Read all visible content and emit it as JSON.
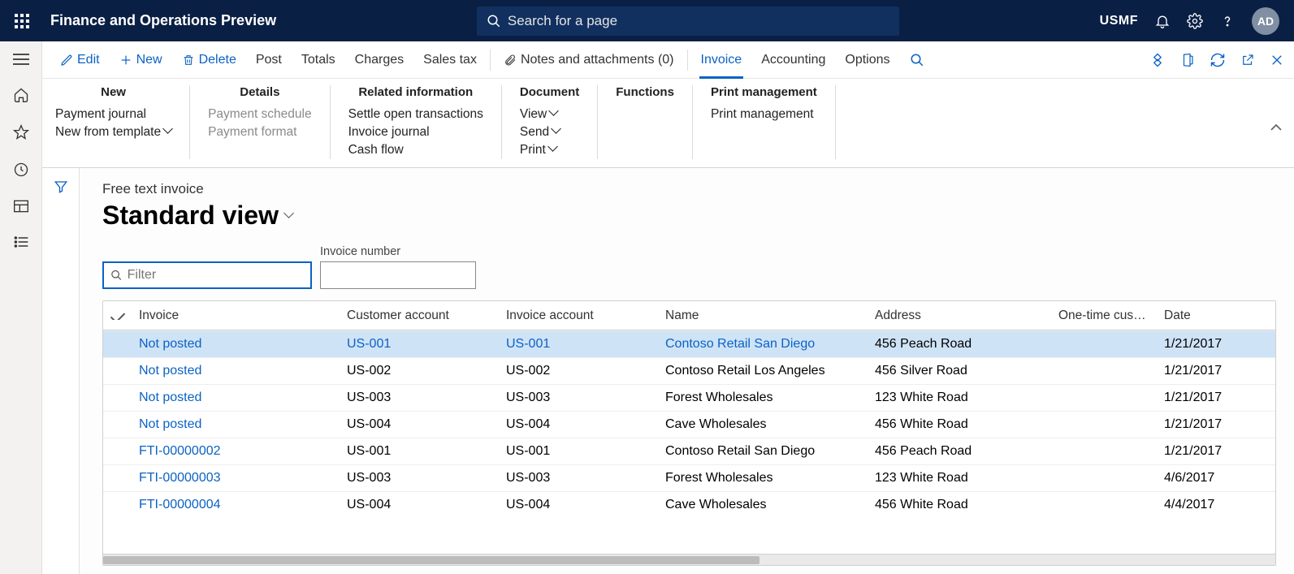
{
  "banner": {
    "title": "Finance and Operations Preview",
    "search_placeholder": "Search for a page",
    "company": "USMF",
    "avatar": "AD"
  },
  "actionbar": {
    "edit": "Edit",
    "new": "New",
    "delete": "Delete",
    "post": "Post",
    "totals": "Totals",
    "charges": "Charges",
    "sales_tax": "Sales tax",
    "notes": "Notes and attachments (0)",
    "invoice": "Invoice",
    "accounting": "Accounting",
    "options": "Options"
  },
  "ribbon": {
    "groups": [
      {
        "title": "New",
        "items": [
          {
            "label": "Payment journal",
            "disabled": false,
            "chevron": false
          },
          {
            "label": "New from template",
            "disabled": false,
            "chevron": true
          }
        ]
      },
      {
        "title": "Details",
        "items": [
          {
            "label": "Payment schedule",
            "disabled": true,
            "chevron": false
          },
          {
            "label": "Payment format",
            "disabled": true,
            "chevron": false
          }
        ]
      },
      {
        "title": "Related information",
        "items": [
          {
            "label": "Settle open transactions",
            "disabled": false,
            "chevron": false
          },
          {
            "label": "Invoice journal",
            "disabled": false,
            "chevron": false
          },
          {
            "label": "Cash flow",
            "disabled": false,
            "chevron": false
          }
        ]
      },
      {
        "title": "Document",
        "items": [
          {
            "label": "View",
            "disabled": false,
            "chevron": true
          },
          {
            "label": "Send",
            "disabled": false,
            "chevron": true
          },
          {
            "label": "Print",
            "disabled": false,
            "chevron": true
          }
        ]
      },
      {
        "title": "Functions",
        "items": []
      },
      {
        "title": "Print management",
        "items": [
          {
            "label": "Print management",
            "disabled": false,
            "chevron": false
          }
        ]
      }
    ]
  },
  "page": {
    "breadcrumb": "Free text invoice",
    "view_title": "Standard view",
    "filter_placeholder": "Filter",
    "invoice_number_label": "Invoice number"
  },
  "grid": {
    "columns": [
      "Invoice",
      "Customer account",
      "Invoice account",
      "Name",
      "Address",
      "One-time cus…",
      "Date"
    ],
    "rows": [
      {
        "invoice": "Not posted",
        "cust": "US-001",
        "iacc": "US-001",
        "name": "Contoso Retail San Diego",
        "addr": "456 Peach Road",
        "one": "",
        "date": "1/21/2017",
        "selected": true
      },
      {
        "invoice": "Not posted",
        "cust": "US-002",
        "iacc": "US-002",
        "name": "Contoso Retail Los Angeles",
        "addr": "456 Silver Road",
        "one": "",
        "date": "1/21/2017",
        "selected": false
      },
      {
        "invoice": "Not posted",
        "cust": "US-003",
        "iacc": "US-003",
        "name": "Forest Wholesales",
        "addr": "123 White Road",
        "one": "",
        "date": "1/21/2017",
        "selected": false
      },
      {
        "invoice": "Not posted",
        "cust": "US-004",
        "iacc": "US-004",
        "name": "Cave Wholesales",
        "addr": "456 White Road",
        "one": "",
        "date": "1/21/2017",
        "selected": false
      },
      {
        "invoice": "FTI-00000002",
        "cust": "US-001",
        "iacc": "US-001",
        "name": "Contoso Retail San Diego",
        "addr": "456 Peach Road",
        "one": "",
        "date": "1/21/2017",
        "selected": false
      },
      {
        "invoice": "FTI-00000003",
        "cust": "US-003",
        "iacc": "US-003",
        "name": "Forest Wholesales",
        "addr": "123 White Road",
        "one": "",
        "date": "4/6/2017",
        "selected": false
      },
      {
        "invoice": "FTI-00000004",
        "cust": "US-004",
        "iacc": "US-004",
        "name": "Cave Wholesales",
        "addr": "456 White Road",
        "one": "",
        "date": "4/4/2017",
        "selected": false
      }
    ]
  }
}
